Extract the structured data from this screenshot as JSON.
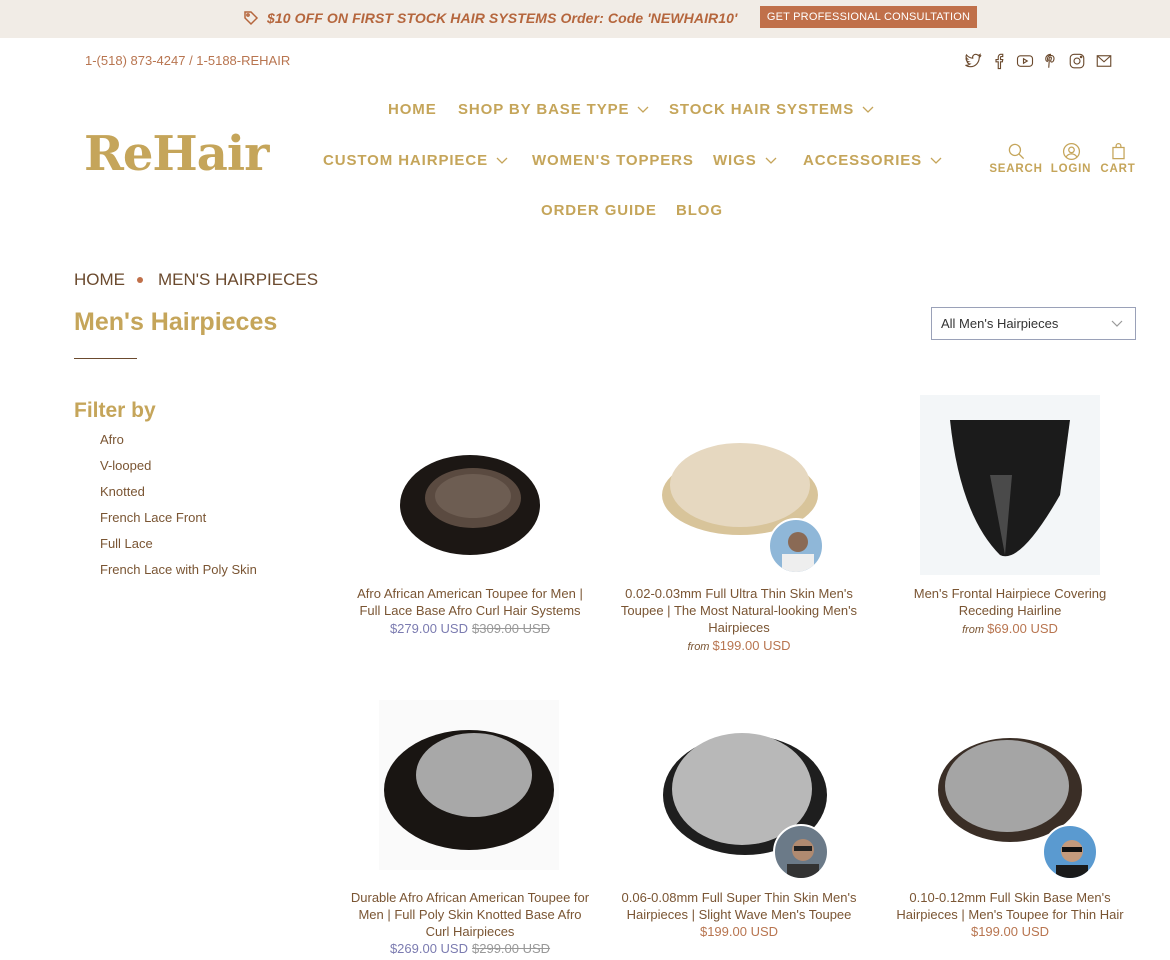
{
  "promo": {
    "text": "$10 OFF ON FIRST STOCK HAIR SYSTEMS Order: Code 'NEWHAIR10'",
    "button_label": "GET PROFESSIONAL CONSULTATION",
    "tag_icon": "tag-icon"
  },
  "header": {
    "phone": "1-(518) 873-4247 / 1-5188-REHAIR",
    "social": [
      "twitter-icon",
      "facebook-icon",
      "youtube-icon",
      "pinterest-icon",
      "instagram-icon",
      "email-icon"
    ],
    "logo": "ReHair"
  },
  "nav": {
    "home": "HOME",
    "shop_by_base": "SHOP BY BASE TYPE",
    "stock_hair": "STOCK HAIR SYSTEMS",
    "custom": "CUSTOM HAIRPIECE",
    "womens": "WOMEN'S TOPPERS",
    "wigs": "WIGS",
    "accessories": "ACCESSORIES",
    "order_guide": "ORDER GUIDE",
    "blog": "BLOG"
  },
  "utility": {
    "search": "SEARCH",
    "login": "LOGIN",
    "cart": "CART"
  },
  "breadcrumb": {
    "home": "HOME",
    "current": "MEN'S HAIRPIECES"
  },
  "page_title": "Men's Hairpieces",
  "sort_select": {
    "value": "All Men's Hairpieces"
  },
  "filter": {
    "title": "Filter by",
    "items": [
      "Afro",
      "V-looped",
      "Knotted",
      "French Lace Front",
      "Full Lace",
      "French Lace with Poly Skin"
    ]
  },
  "products": [
    {
      "title": "Afro African American Toupee for Men | Full Lace Base Afro Curl Hair Systems",
      "price": "$279.00 USD",
      "old_price": "$309.00 USD"
    },
    {
      "title": "0.02-0.03mm Full Ultra Thin Skin Men's Toupee | The Most Natural-looking Men's Hairpieces",
      "from_label": "from",
      "price": "$199.00 USD"
    },
    {
      "title": "Men's Frontal Hairpiece Covering Receding Hairline",
      "from_label": "from",
      "price": "$69.00 USD"
    },
    {
      "title": "Durable Afro African American Toupee for Men | Full Poly Skin Knotted Base Afro Curl Hairpieces",
      "price": "$269.00 USD",
      "old_price": "$299.00 USD"
    },
    {
      "title": "0.06-0.08mm Full Super Thin Skin Men's Hairpieces | Slight Wave Men's Toupee",
      "price": "$199.00 USD"
    },
    {
      "title": "0.10-0.12mm Full Skin Base Men's Hairpieces | Men's Toupee for Thin Hair",
      "price": "$199.00 USD"
    }
  ],
  "colors": {
    "gold": "#c5a55a",
    "brown": "#6b4a2e",
    "promo_bg": "#f1ece6",
    "accent": "#c0704a",
    "sale_price": "#7b7bb0"
  }
}
